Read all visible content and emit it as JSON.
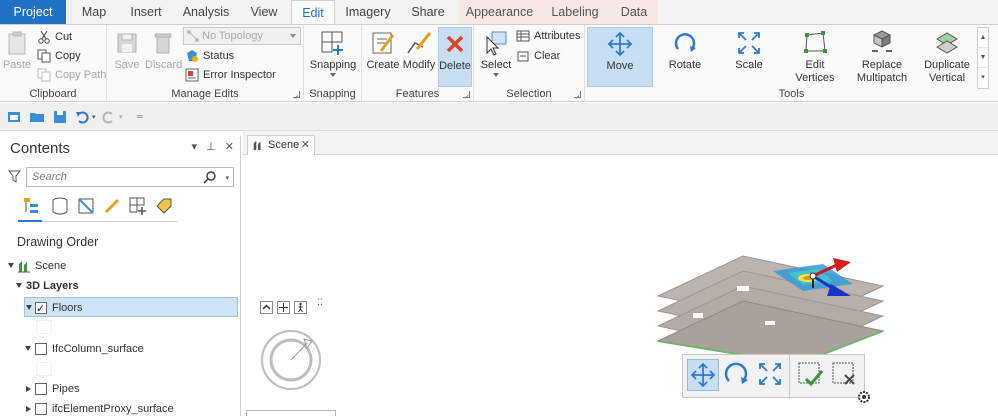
{
  "tabs": [
    "Project",
    "Map",
    "Insert",
    "Analysis",
    "View",
    "Edit",
    "Imagery",
    "Share",
    "Appearance",
    "Labeling",
    "Data"
  ],
  "active_tab": "Edit",
  "clipboard": {
    "paste": "Paste",
    "cut": "Cut",
    "copy": "Copy",
    "copy_path": "Copy Path",
    "group": "Clipboard"
  },
  "manage_edits": {
    "save": "Save",
    "discard": "Discard",
    "topology": "No Topology",
    "status": "Status",
    "error_inspector": "Error Inspector",
    "group": "Manage Edits"
  },
  "snapping": {
    "label": "Snapping",
    "group": "Snapping"
  },
  "features": {
    "create": "Create",
    "modify": "Modify",
    "delete": "Delete",
    "group": "Features"
  },
  "selection": {
    "select": "Select",
    "attributes": "Attributes",
    "clear": "Clear",
    "group": "Selection"
  },
  "tools": {
    "move": "Move",
    "rotate": "Rotate",
    "scale": "Scale",
    "edit_vertices_1": "Edit",
    "edit_vertices_2": "Vertices",
    "replace_1": "Replace",
    "replace_2": "Multipatch",
    "duplicate_1": "Duplicate",
    "duplicate_2": "Vertical",
    "group": "Tools"
  },
  "contents": {
    "title": "Contents",
    "search_placeholder": "Search",
    "drawing_order": "Drawing Order",
    "items": [
      {
        "label": "Scene"
      },
      {
        "label": "3D Layers"
      },
      {
        "label": "Floors",
        "checked": true
      },
      {
        "label": "IfcColumn_surface",
        "checked": false
      },
      {
        "label": "Pipes",
        "checked": false
      },
      {
        "label": "ifcElementProxy_surface",
        "checked": false
      }
    ]
  },
  "view": {
    "tab_label": "Scene"
  },
  "colors": {
    "accent": "#1f72c4",
    "selected_bg": "#c8dff3",
    "delete_red": "#d9442c"
  }
}
